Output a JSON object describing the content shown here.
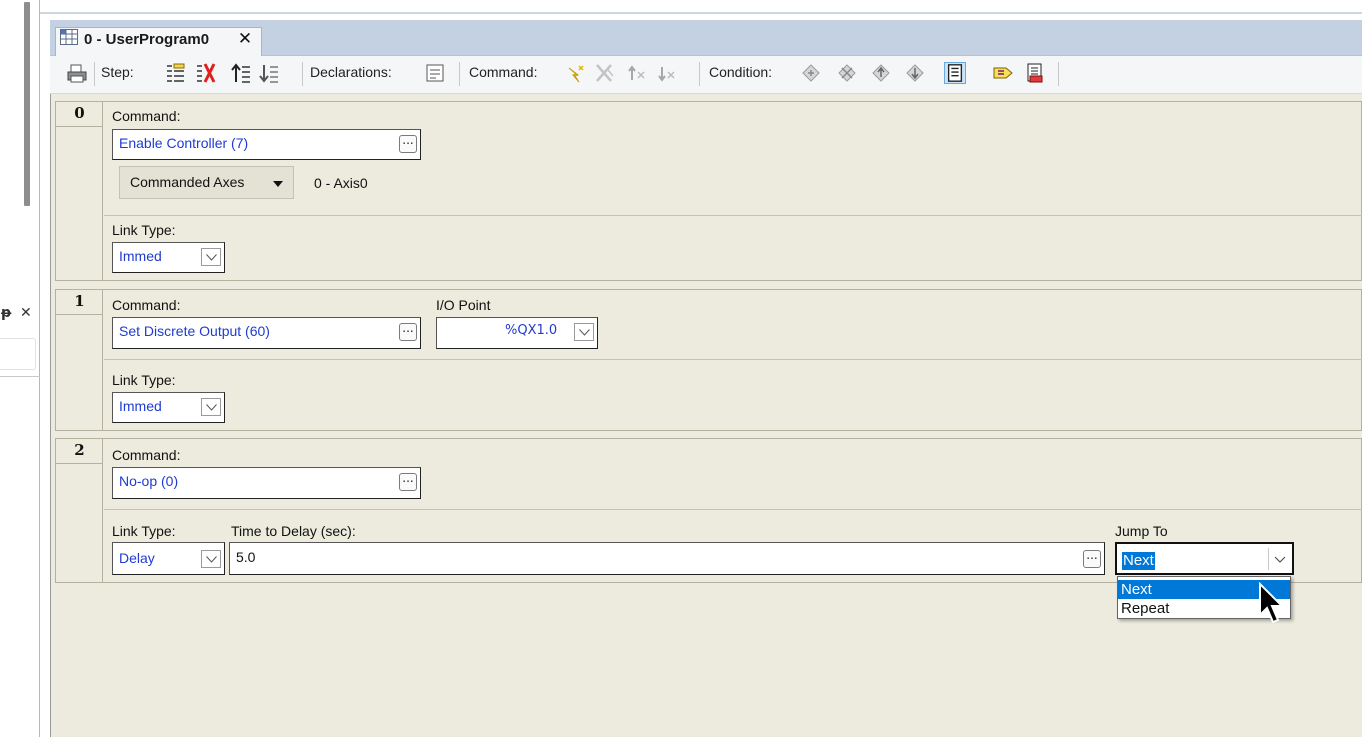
{
  "left_panel": {
    "pin_glyph": "ᵽ",
    "close_glyph": "✕"
  },
  "tab": {
    "title": "0 - UserProgram0",
    "close_glyph": "✕"
  },
  "toolbar": {
    "step_label": "Step:",
    "declarations_label": "Declarations:",
    "command_label": "Command:",
    "condition_label": "Condition:"
  },
  "steps": [
    {
      "number": "0",
      "command_label": "Command:",
      "command_value": "Enable Controller (7)",
      "axes_button_label": "Commanded Axes",
      "axes_value": "0 - Axis0",
      "link_type_label": "Link Type:",
      "link_type_value": "Immed"
    },
    {
      "number": "1",
      "command_label": "Command:",
      "command_value": "Set Discrete Output (60)",
      "io_point_label": "I/O Point",
      "io_point_value": "%QX1.0",
      "link_type_label": "Link Type:",
      "link_type_value": "Immed"
    },
    {
      "number": "2",
      "command_label": "Command:",
      "command_value": "No-op (0)",
      "link_type_label": "Link Type:",
      "link_type_value": "Delay",
      "delay_label": "Time to Delay (sec):",
      "delay_value": "5.0",
      "jump_to_label": "Jump To",
      "jump_to_value": "Next",
      "jump_to_options": [
        "Next",
        "Repeat"
      ]
    }
  ],
  "colors": {
    "value_text": "#1f3cd0",
    "selection": "#0078d7",
    "panel_bg": "#ecebde"
  }
}
